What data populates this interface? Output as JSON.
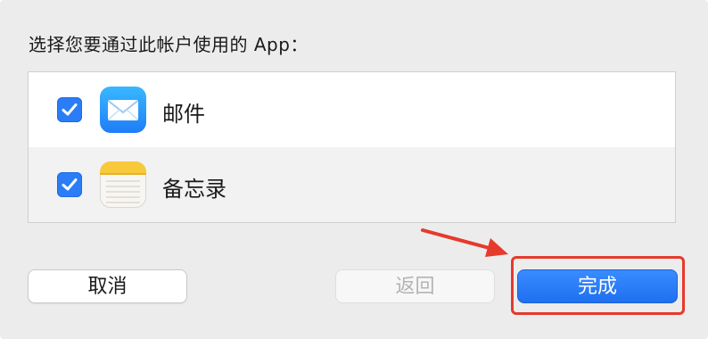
{
  "dialog": {
    "prompt": "选择您要通过此帐户使用的 App："
  },
  "apps": [
    {
      "label": "邮件",
      "checked": true,
      "icon": "mail-icon"
    },
    {
      "label": "备忘录",
      "checked": true,
      "icon": "notes-icon"
    }
  ],
  "buttons": {
    "cancel": "取消",
    "back": "返回",
    "done": "完成"
  },
  "colors": {
    "accent": "#2a7df6",
    "annotation": "#e53a2c"
  }
}
